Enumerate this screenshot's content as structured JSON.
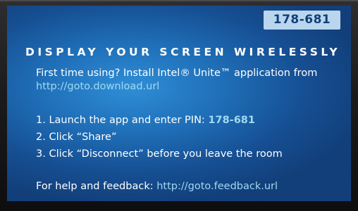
{
  "pin_badge": "178-681",
  "headline": "DISPLAY YOUR SCREEN WIRELESSLY",
  "intro": {
    "text": "First time using? Install Intel® Unite™ application from",
    "download_url": "http://goto.download.url"
  },
  "steps": [
    {
      "text": "1. Launch the app and enter PIN: ",
      "pin": "178-681"
    },
    {
      "text": "2. Click “Share”"
    },
    {
      "text": "3. Click “Disconnect” before you leave the room"
    }
  ],
  "help": {
    "text": "For help and feedback: ",
    "feedback_url": "http://goto.feedback.url"
  },
  "colors": {
    "screen_blue": "#1f6fb8",
    "badge_bg": "#b9d6ee",
    "link_cyan": "#9fd9f4"
  }
}
